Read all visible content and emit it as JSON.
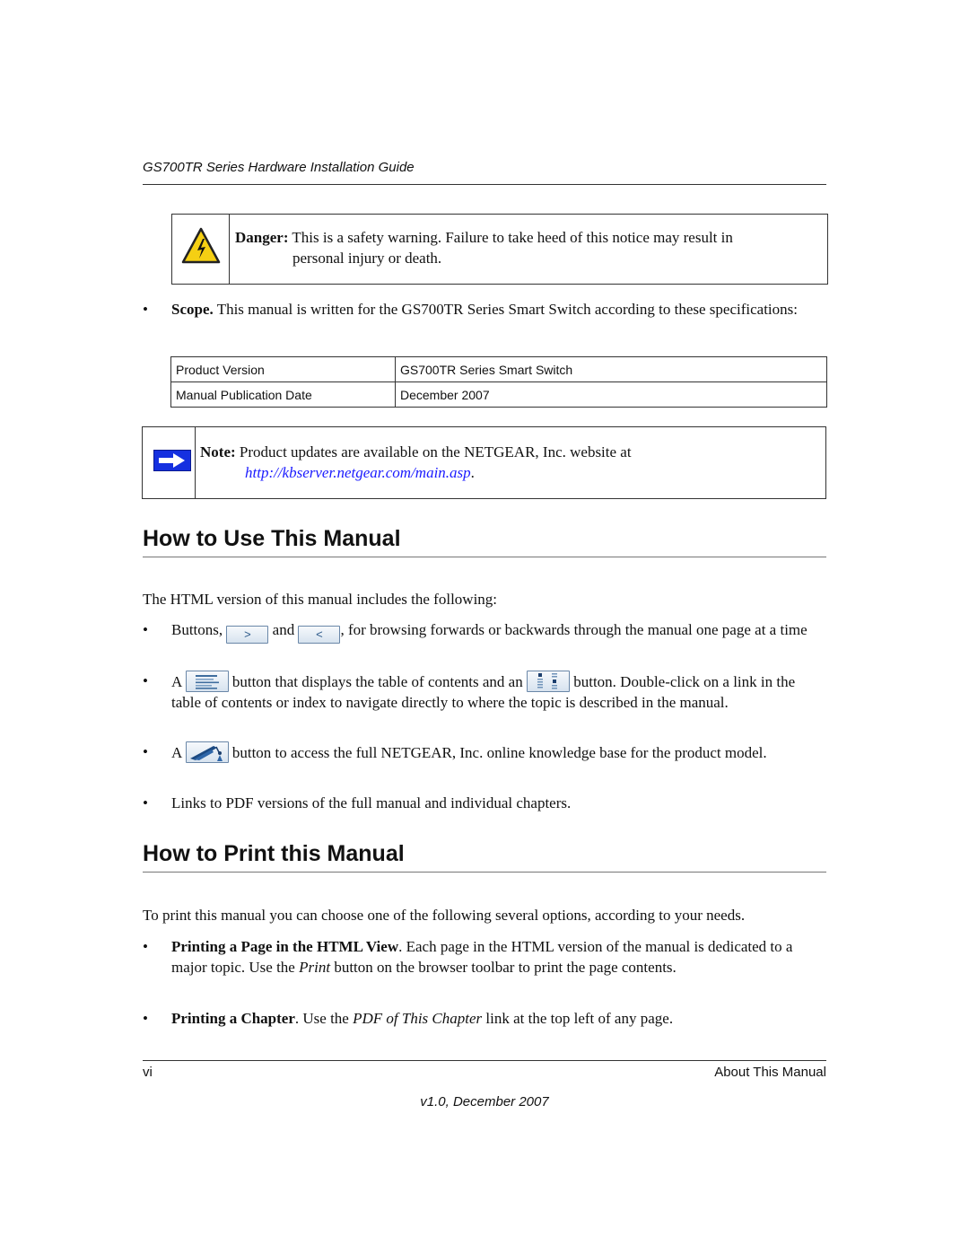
{
  "header": {
    "running_title": "GS700TR Series Hardware Installation Guide"
  },
  "danger": {
    "icon": "electrical-hazard-warning-icon",
    "label": "Danger:",
    "line1": " This is a safety warning. Failure to take heed of this notice may result in",
    "line2": "personal injury or death."
  },
  "scope": {
    "label": "Scope.",
    "text": " This manual is written for the GS700TR Series Smart Switch according to these specifications:"
  },
  "spec_table": {
    "rows": [
      {
        "key": "Product Version",
        "value": "GS700TR Series Smart Switch"
      },
      {
        "key": "Manual Publication Date",
        "value": "December 2007"
      }
    ]
  },
  "note": {
    "icon": "right-arrow-note-icon",
    "label": "Note:",
    "line1": " Product updates are available on the NETGEAR, Inc. website at",
    "link": "http://kbserver.netgear.com/main.asp",
    "after_link": "."
  },
  "use_section": {
    "title": "How to Use This Manual",
    "intro": "The HTML version of this manual includes the following:",
    "bullet1": {
      "pre": "Buttons, ",
      "next_button": ">",
      "mid": " and ",
      "prev_button": "<",
      "post": ", for browsing forwards or backwards through the manual one page at a time"
    },
    "bullet2": {
      "pre": "A ",
      "toc_icon": "table-of-contents-icon",
      "mid": " button that displays the table of contents and an ",
      "index_icon": "index-icon",
      "post": " button. Double-click on a link in the table of contents or index to navigate directly to where the topic is described in the manual."
    },
    "bullet3": {
      "pre": "A ",
      "kb_icon": "knowledge-base-icon",
      "post": " button to access the full NETGEAR, Inc. online knowledge base for the product model."
    },
    "bullet4": "Links to PDF versions of the full manual and individual chapters."
  },
  "print_section": {
    "title": "How to Print this Manual",
    "intro": "To print this manual you can choose one of the following several options, according to your needs.",
    "bullet1": {
      "bold": "Printing a Page in the HTML View",
      "pre": ". Each page in the HTML version of the manual is dedicated to a major topic. Use the ",
      "italic": "Print",
      "post": " button on the browser toolbar to print the page contents."
    },
    "bullet2": {
      "bold": "Printing a Chapter",
      "pre": ". Use the ",
      "italic": "PDF of This Chapter",
      "post": " link at the top left of any page."
    }
  },
  "footer": {
    "page_number": "vi",
    "section": "About This Manual",
    "version": "v1.0, December 2007"
  }
}
